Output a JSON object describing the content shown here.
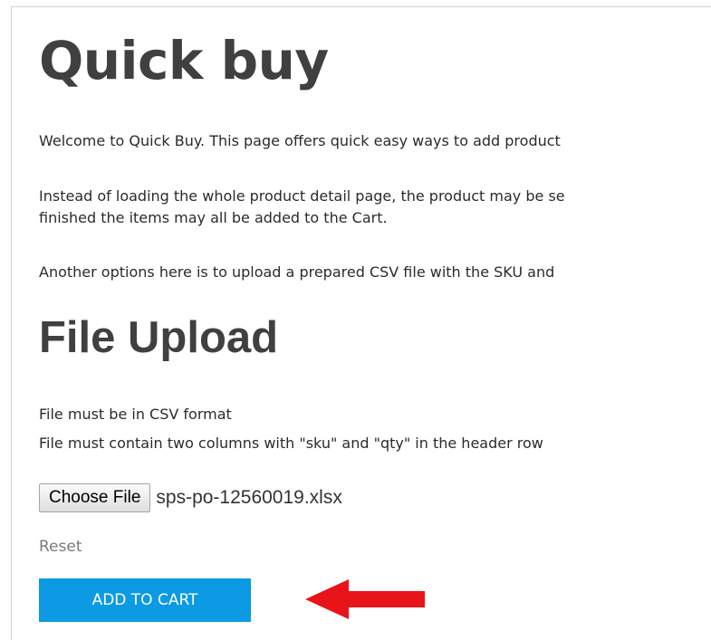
{
  "page": {
    "title": "Quick buy",
    "intro": "Welcome to Quick Buy. This page offers quick easy ways to add product",
    "instructions_line1": "Instead of loading the whole product detail page, the product may be se",
    "instructions_line2": "finished the items may all be added to the Cart.",
    "csv_option": "Another options here is to upload a prepared CSV file with the SKU and"
  },
  "file_upload": {
    "heading": "File Upload",
    "requirement_format": "File must be in CSV format",
    "requirement_columns": "File must contain two columns with \"sku\" and \"qty\" in the header row",
    "choose_file_label": "Choose File",
    "selected_file": "sps-po-12560019.xlsx",
    "reset_label": "Reset",
    "add_to_cart_label": "ADD TO CART"
  },
  "colors": {
    "primary_button": "#0b9ae3",
    "annotation_arrow": "#e8141a"
  },
  "icons": {
    "annotation": "red-arrow-left-icon"
  }
}
